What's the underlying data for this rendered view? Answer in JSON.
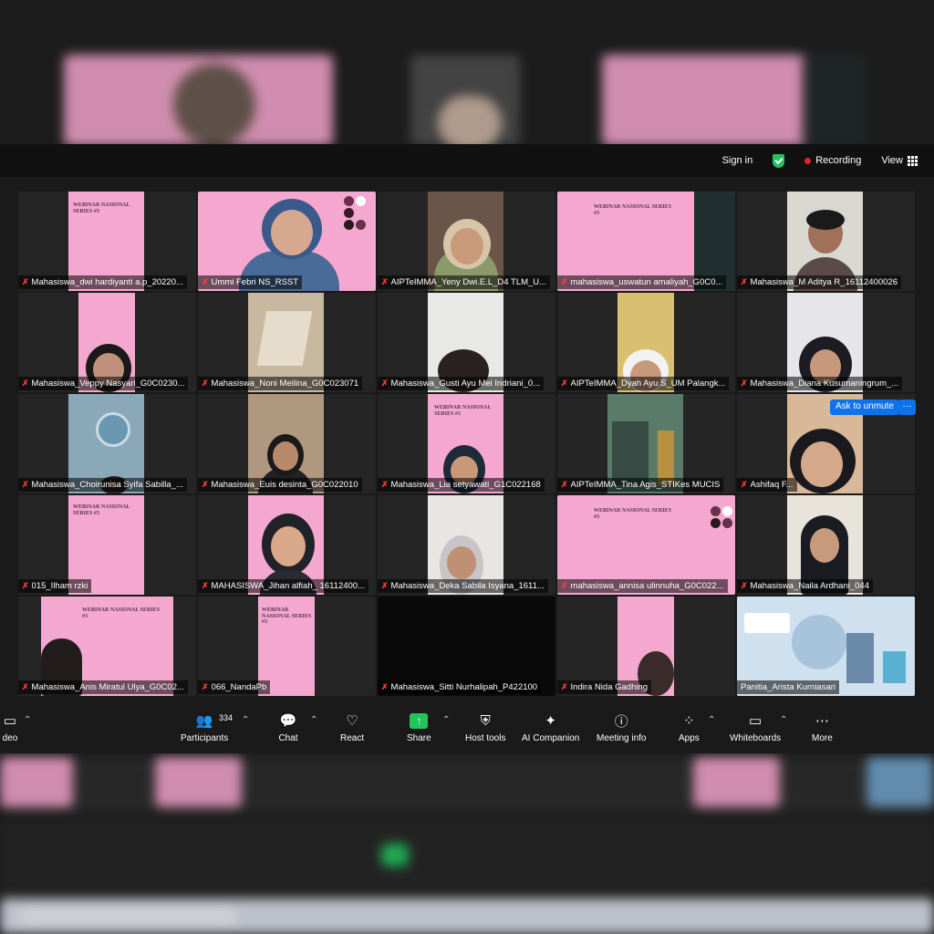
{
  "topbar": {
    "sign_in": "Sign in",
    "recording": "Recording",
    "view": "View"
  },
  "participants": [
    {
      "name": "Mahasiswa_dwi hardiyanti a.p_20220..."
    },
    {
      "name": "Ummi Febri NS_RSST"
    },
    {
      "name": "AIPTeIMMA_Yeny Dwi.E.L_D4 TLM_U..."
    },
    {
      "name": "mahasiswa_uswatun amaliyah_G0C0..."
    },
    {
      "name": "Mahasiswa_M Aditya R_16112400026"
    },
    {
      "name": "Mahasiswa_Veppy Nasyari_G0C0230..."
    },
    {
      "name": "Mahasiswa_Noni Meilina_G0C023071"
    },
    {
      "name": "Mahasiswa_Gusti Ayu Mei Indriani_0..."
    },
    {
      "name": "AIPTeIMMA_Dyah Ayu S_UM Palangk..."
    },
    {
      "name": "Mahasiswa_Diana Kusumaningrum_..."
    },
    {
      "name": "Mahasiswa_Choirunisa Syifa Sabilla_..."
    },
    {
      "name": "Mahasiswa_Euis desinta_G0C022010"
    },
    {
      "name": "Mahasiswa_Lia setyawati_G1C022168"
    },
    {
      "name": "AIPTeIMMA_Tina Agis_STIKes MUCIS"
    },
    {
      "name": "Ashifaq F..."
    },
    {
      "name": "015_Ilham rzki"
    },
    {
      "name": "MAHASISWA_Jihan alfiah_ 16112400..."
    },
    {
      "name": "Mahasiswa_Deka Sabila Isyana_1611..."
    },
    {
      "name": "mahasiswa_annisa ulinnuha_G0C022..."
    },
    {
      "name": "Mahasiswa_Naila Ardhani_044"
    },
    {
      "name": "Mahasiswa_Anis Miratul Ulya_G0C02..."
    },
    {
      "name": "066_NandaPb"
    },
    {
      "name": "Mahasiswa_Sitti Nurhalipah_P422100"
    },
    {
      "name": "Indira Nida Gadhing"
    },
    {
      "name": "Panitia_Arista Kurniasari"
    }
  ],
  "unmute": {
    "label": "Ask to unmute",
    "more": "···"
  },
  "slide_text": "WEBINAR NASIONAL SERIES #3",
  "toolbar": {
    "video_label": "deo",
    "participants_label": "Participants",
    "participants_count": "334",
    "chat": "Chat",
    "react": "React",
    "share": "Share",
    "host_tools": "Host tools",
    "ai_companion": "AI Companion",
    "meeting_info": "Meeting info",
    "apps": "Apps",
    "whiteboards": "Whiteboards",
    "more": "More"
  },
  "colors": {
    "accent_blue": "#0e72ed",
    "share_green": "#23c45e",
    "recording_red": "#e02828",
    "slide_pink": "#f4a8cf"
  }
}
